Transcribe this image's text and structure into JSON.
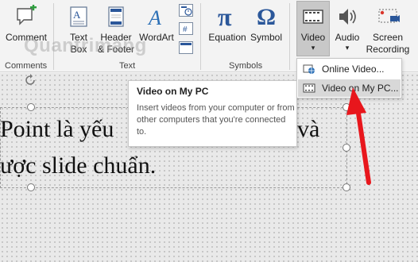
{
  "ribbon": {
    "buttons": {
      "comment": "Comment",
      "text_box_1": "Text",
      "text_box_2": "Box",
      "header_footer_1": "Header",
      "header_footer_2": "& Footer",
      "wordart": "WordArt",
      "equation": "Equation",
      "symbol": "Symbol",
      "video": "Video",
      "audio": "Audio",
      "screen_recording_1": "Screen",
      "screen_recording_2": "Recording"
    },
    "groups": {
      "comments": "Comments",
      "text": "Text",
      "symbols": "Symbols"
    },
    "dropdown_arrow": "▾",
    "icons": [
      "comment-icon",
      "text-box-icon",
      "header-footer-icon",
      "wordart-icon",
      "date-time-icon",
      "slide-number-icon",
      "object-icon",
      "equation-icon",
      "symbol-icon",
      "video-icon",
      "audio-icon",
      "screen-recording-icon"
    ],
    "accent_color": "#2b579a"
  },
  "tooltip": {
    "title": "Video on My PC",
    "description": "Insert videos from your computer or from other computers that you're connected to."
  },
  "video_menu": {
    "items": [
      {
        "label": "Online Video...",
        "icon": "online-video-icon"
      },
      {
        "label": "Video on My PC...",
        "icon": "video-file-icon",
        "highlighted": true
      }
    ]
  },
  "slide": {
    "line1": "Point là yếu",
    "line1_end": "và",
    "line2": "ược slide chuẩn."
  },
  "annotation": {
    "arrow_color": "#e8161c"
  },
  "watermark": "Quantrimang"
}
